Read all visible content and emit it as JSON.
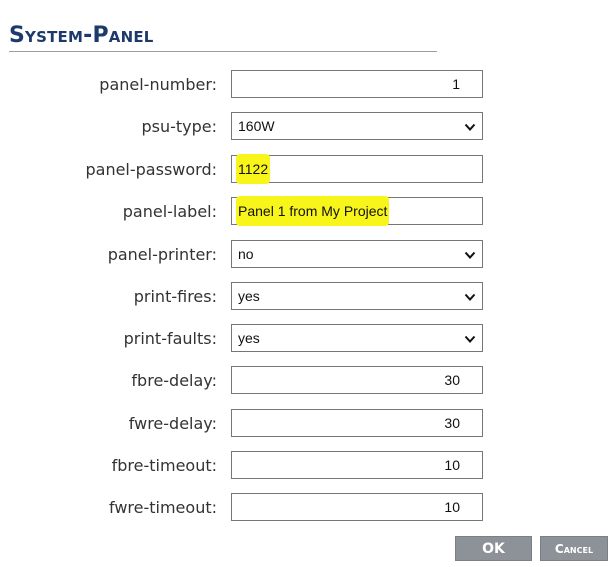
{
  "dialog": {
    "title": "System-Panel"
  },
  "fields": {
    "panel_number": {
      "label": "panel-number:",
      "value": "1"
    },
    "psu_type": {
      "label": "psu-type:",
      "value": "160W"
    },
    "panel_password": {
      "label": "panel-password:",
      "value": "1122"
    },
    "panel_label": {
      "label": "panel-label:",
      "value": "Panel 1 from My Project"
    },
    "panel_printer": {
      "label": "panel-printer:",
      "value": "no"
    },
    "print_fires": {
      "label": "print-fires:",
      "value": "yes"
    },
    "print_faults": {
      "label": "print-faults:",
      "value": "yes"
    },
    "fbre_delay": {
      "label": "fbre-delay:",
      "value": "30"
    },
    "fwre_delay": {
      "label": "fwre-delay:",
      "value": "30"
    },
    "fbre_timeout": {
      "label": "fbre-timeout:",
      "value": "10"
    },
    "fwre_timeout": {
      "label": "fwre-timeout:",
      "value": "10"
    }
  },
  "buttons": {
    "ok": "OK",
    "cancel": "Cancel"
  },
  "colors": {
    "title": "#1d3a6b",
    "highlight": "#f8f51a",
    "button": "#8d9298"
  },
  "icons": {
    "dropdown": "chevron-down-icon"
  }
}
